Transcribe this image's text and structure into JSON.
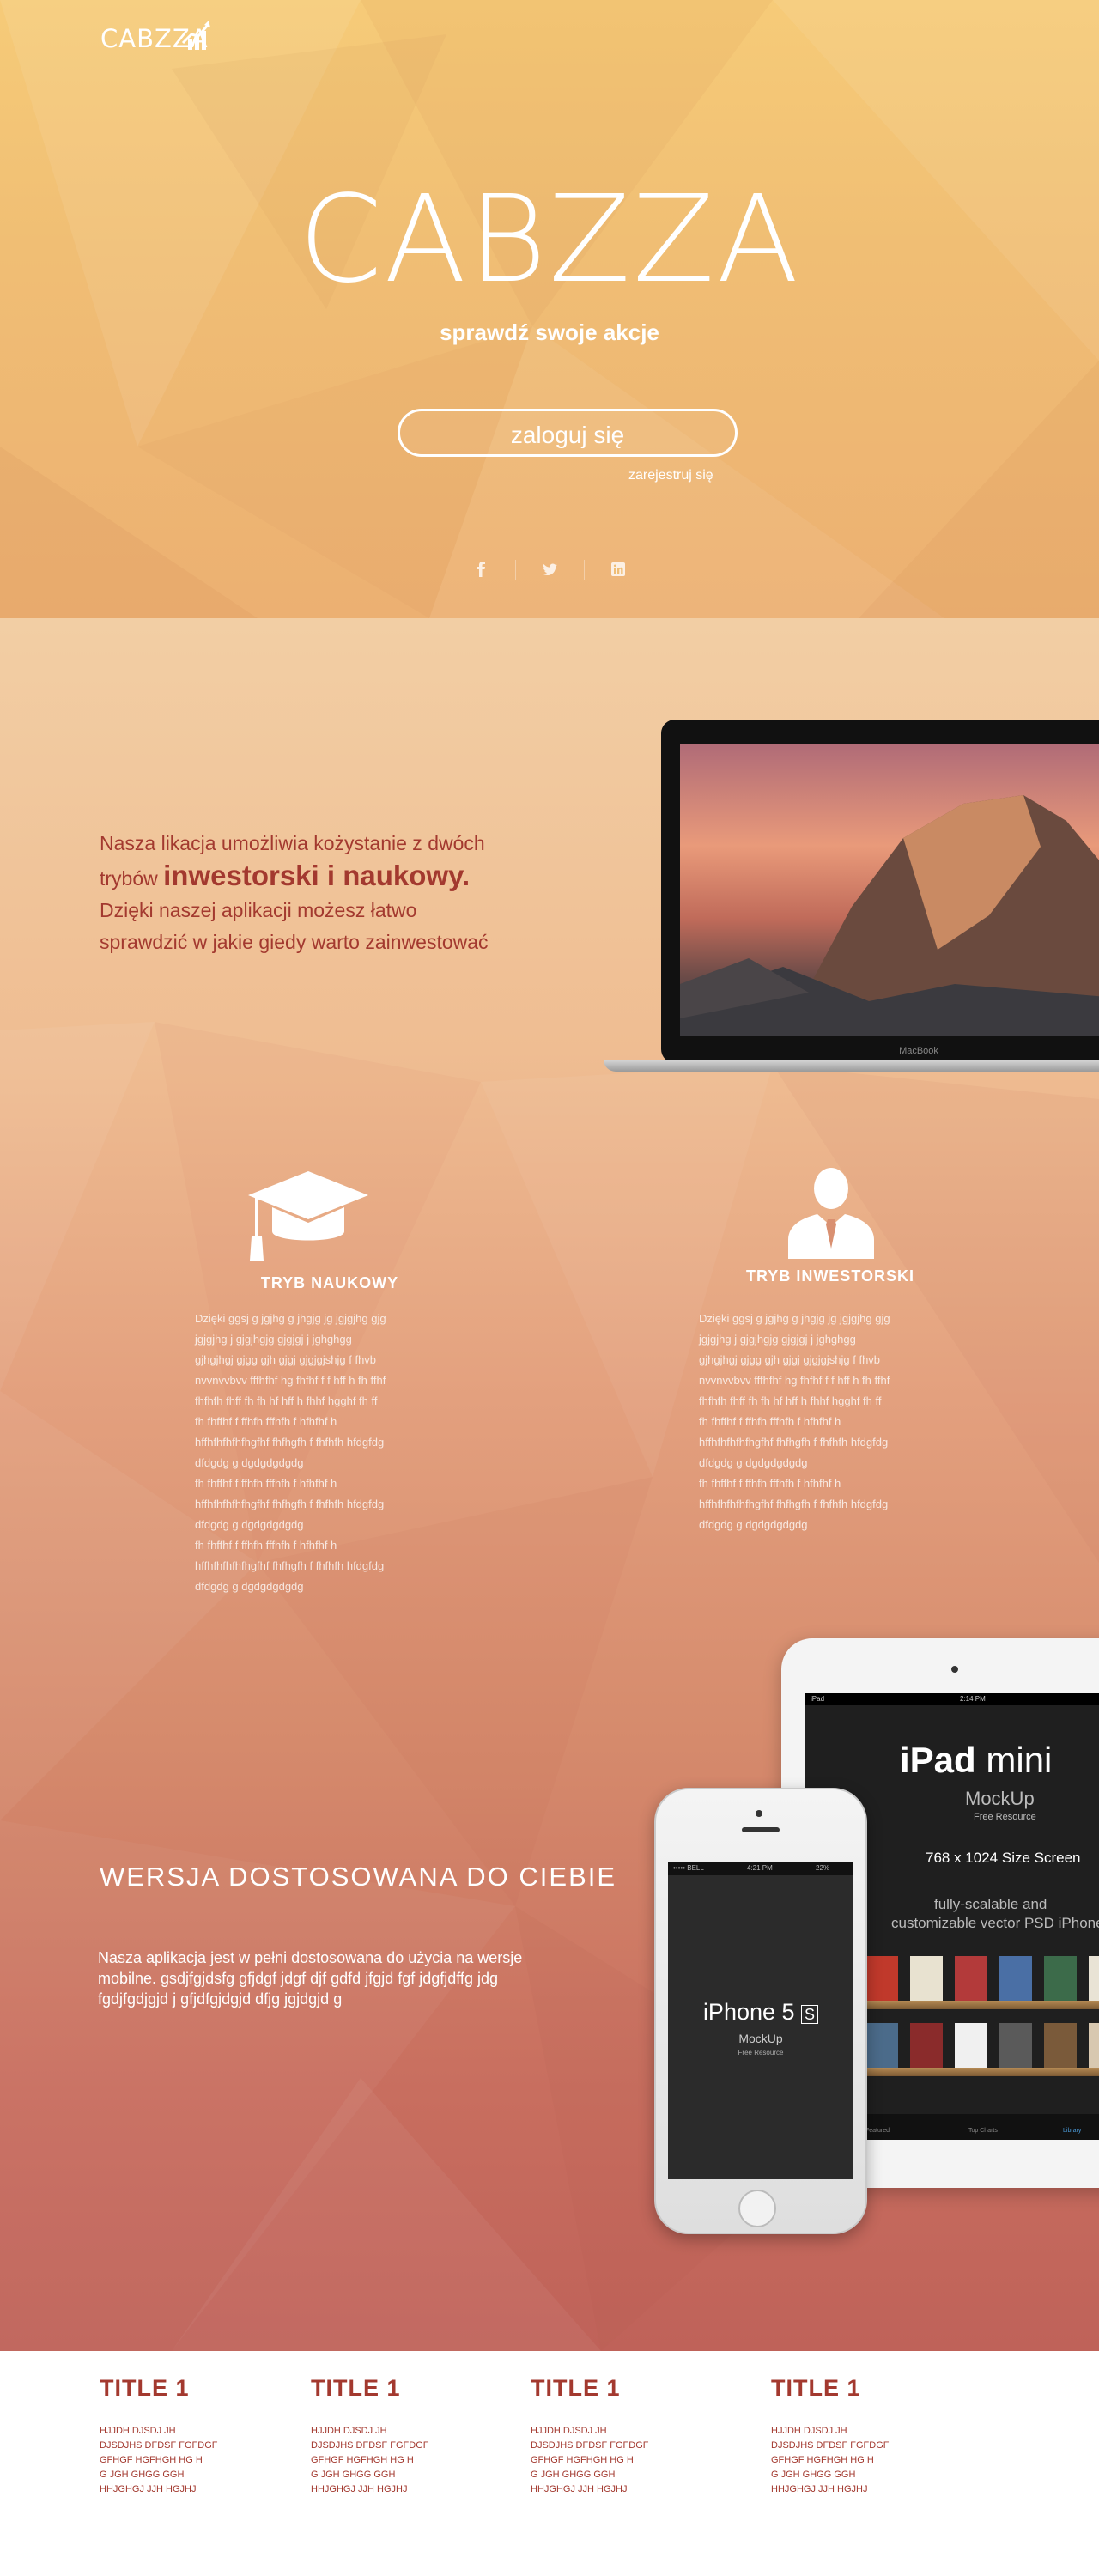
{
  "header": {
    "logo_text": "CABZZA",
    "hero_title": "CABZZA",
    "hero_subtitle": "sprawdź swoje akcje",
    "login_label": "zaloguj się",
    "register_label": "zarejestruj się",
    "social_icons": [
      "facebook-icon",
      "twitter-icon",
      "linkedin-icon"
    ]
  },
  "intro": {
    "line1": "Nasza likacja umożliwia kożystanie z dwóch",
    "line2_prefix": "trybów ",
    "line2_bold": "inwestorski i naukowy.",
    "line3": "Dzięki naszej aplikacji możesz łatwo",
    "line4": "sprawdzić w jakie giedy warto zainwestować",
    "laptop_label": "MacBook"
  },
  "modes": [
    {
      "title": "TRYB NAUKOWY",
      "icon": "graduation-cap-icon",
      "text": "Dzięki   ggsj g jgjhg g jhgjg jg jgjgjhg  gjg\njgjgjhg j gjgjhgjg  gjgjgj j jghghgg\ngjhgjhgj gjgg gjh gjgj gjgjgjshjg f fhvb\nnvvnvvbvv fffhfhf hg fhfhf f f hff h fh ffhf\nfhfhfh fhff   fh fh  hf hff h fhhf hgghf fh ff\nfh fhffhf f ffhfh fffhfh f hfhfhf h\nhffhfhfhfhfhgfhf  fhfhgfh f fhfhfh hfdgfdg\ndfdgdg g dgdgdgdgdg\nfh fhffhf f ffhfh fffhfh f hfhfhf h\nhffhfhfhfhfhgfhf  fhfhgfh f fhfhfh hfdgfdg\ndfdgdg g dgdgdgdgdg\nfh fhffhf f ffhfh fffhfh f hfhfhf h\nhffhfhfhfhfhgfhf  fhfhgfh f fhfhfh hfdgfdg\ndfdgdg g dgdgdgdgdg"
    },
    {
      "title": "TRYB INWESTORSKI",
      "icon": "businessman-icon",
      "text": "Dzięki   ggsj g jgjhg g jhgjg jg jgjgjhg  gjg\njgjgjhg j gjgjhgjg  gjgjgj j jghghgg\ngjhgjhgj gjgg gjh gjgj gjgjgjshjg f fhvb\nnvvnvvbvv fffhfhf hg fhfhf f f hff h fh ffhf\nfhfhfh fhff   fh fh  hf hff h fhhf hgghf fh ff\nfh fhffhf f ffhfh fffhfh f hfhfhf h\nhffhfhfhfhfhgfhf  fhfhgfh f fhfhfh hfdgfdg\ndfdgdg g dgdgdgdgdg\nfh fhffhf f ffhfh fffhfh f hfhfhf h\nhffhfhfhfhfhgfhf  fhfhgfh f fhfhfh hfdgfdg\ndfdgdg g dgdgdgdgdg"
    }
  ],
  "mobile": {
    "title": "WERSJA DOSTOSOWANA DO CIEBIE",
    "text": "Nasza aplikacja jest w pełni dostosowana do użycia na wersje mobilne. gsdjfgjdsfg gfjdgf jdgf djf gdfd jfgjd fgf jdgfjdffg jdg  fgdjfgdjgjd j gfjdfgjdgjd dfjg jgjdgjd g",
    "ipad": {
      "status_left": "iPad",
      "status_center": "2:14 PM",
      "title_bold": "iPad",
      "title_rest": " mini",
      "mockup": "MockUp",
      "free": "Free Resource",
      "size": "768 x 1024 Size Screen",
      "desc_line1": "fully-scalable and",
      "desc_line2": "customizable vector PSD iPhone",
      "tab1": "Featured",
      "tab2": "Top Charts",
      "tab3": "Library"
    },
    "iphone": {
      "status_left": "••••• BELL",
      "status_center": "4:21 PM",
      "status_right": "22%",
      "title": "iPhone 5",
      "title_badge": "S",
      "mockup": "MockUp",
      "free": "Free Resource"
    }
  },
  "footer": {
    "columns": [
      {
        "title": "TITLE 1",
        "text": "HJJDH DJSDJ JH\nDJSDJHS  DFDSF FGFDGF\nGFHGF  HGFHGH HG H\nG JGH GHGG GGH\n HHJGHGJ JJH   HGJHJ"
      },
      {
        "title": "TITLE 1",
        "text": "HJJDH DJSDJ JH\nDJSDJHS  DFDSF FGFDGF\nGFHGF  HGFHGH HG H\nG JGH GHGG GGH\n HHJGHGJ JJH   HGJHJ"
      },
      {
        "title": "TITLE 1",
        "text": "HJJDH DJSDJ JH\nDJSDJHS  DFDSF FGFDGF\nGFHGF  HGFHGH HG H\nG JGH GHGG GGH\n HHJGHGJ JJH   HGJHJ"
      },
      {
        "title": "TITLE 1",
        "text": "HJJDH DJSDJ JH\nDJSDJHS  DFDSF FGFDGF\n GFHGF  HGFHGH HG H\nG JGH GHGG GGH\n HHJGHGJ JJH   HGJHJ"
      }
    ]
  },
  "colors": {
    "hero_top": "#f6cb78",
    "accent_red": "#a3392f",
    "section_bottom": "#bf6259"
  }
}
